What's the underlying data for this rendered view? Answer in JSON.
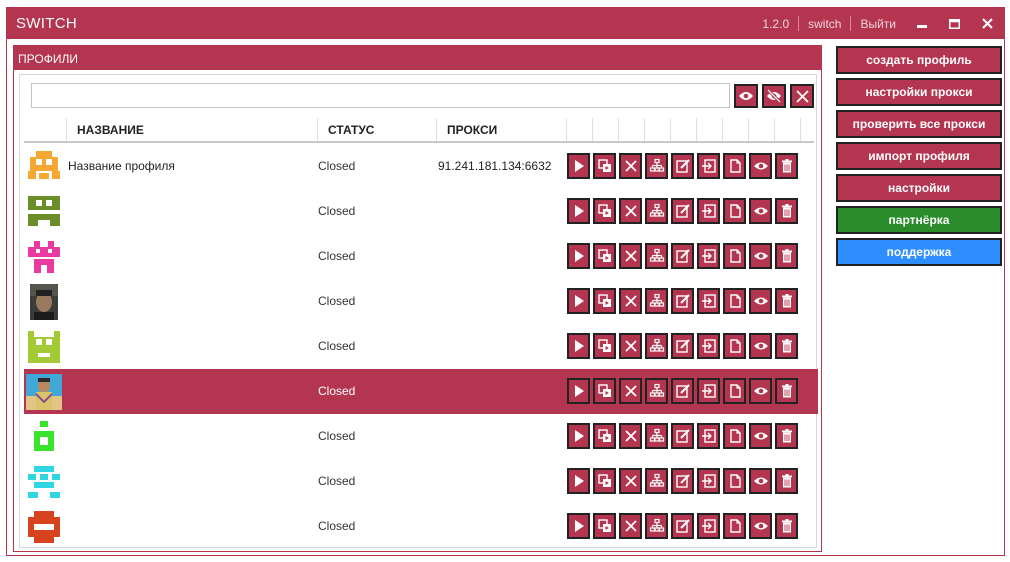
{
  "window": {
    "title": "SWITCH",
    "version": "1.2.0",
    "user": "switch",
    "logout": "Выйти"
  },
  "colors": {
    "accent": "#b33550",
    "partner": "#2b8c2b",
    "support": "#2e8eff"
  },
  "profiles_panel": {
    "header": "ПРОФИЛИ",
    "search": {
      "value": "",
      "placeholder": ""
    },
    "columns": {
      "name": "НАЗВАНИЕ",
      "status": "СТАТУС",
      "proxy": "ПРОКСИ"
    },
    "rows": [
      {
        "avatar": "pixel-avatar-orange",
        "name": "Название профиля",
        "status": "Closed",
        "proxy": "91.241.181.134:6632",
        "selected": false
      },
      {
        "avatar": "pixel-avatar-olive",
        "name": "",
        "status": "Closed",
        "proxy": "",
        "selected": false
      },
      {
        "avatar": "pixel-avatar-magenta",
        "name": "",
        "status": "Closed",
        "proxy": "",
        "selected": false
      },
      {
        "avatar": "photo-avatar-dark",
        "name": "",
        "status": "Closed",
        "proxy": "",
        "selected": false
      },
      {
        "avatar": "pixel-avatar-lime",
        "name": "",
        "status": "Closed",
        "proxy": "",
        "selected": false
      },
      {
        "avatar": "photo-avatar-beach",
        "name": "",
        "status": "Closed",
        "proxy": "",
        "selected": true
      },
      {
        "avatar": "pixel-avatar-green",
        "name": "",
        "status": "Closed",
        "proxy": "",
        "selected": false
      },
      {
        "avatar": "pixel-avatar-cyan",
        "name": "",
        "status": "Closed",
        "proxy": "",
        "selected": false
      },
      {
        "avatar": "pixel-avatar-red",
        "name": "",
        "status": "Closed",
        "proxy": "",
        "selected": false
      }
    ],
    "row_actions": [
      "play-icon",
      "clone-icon",
      "close-icon",
      "network-icon",
      "edit-icon",
      "export-icon",
      "file-icon",
      "eye-icon",
      "trash-icon"
    ]
  },
  "sidebar": {
    "create_profile": "создать профиль",
    "proxy_settings": "настройки прокси",
    "check_all_proxies": "проверить все прокси",
    "import_profile": "импорт профиля",
    "settings": "настройки",
    "partner": "партнёрка",
    "support": "поддержка"
  }
}
